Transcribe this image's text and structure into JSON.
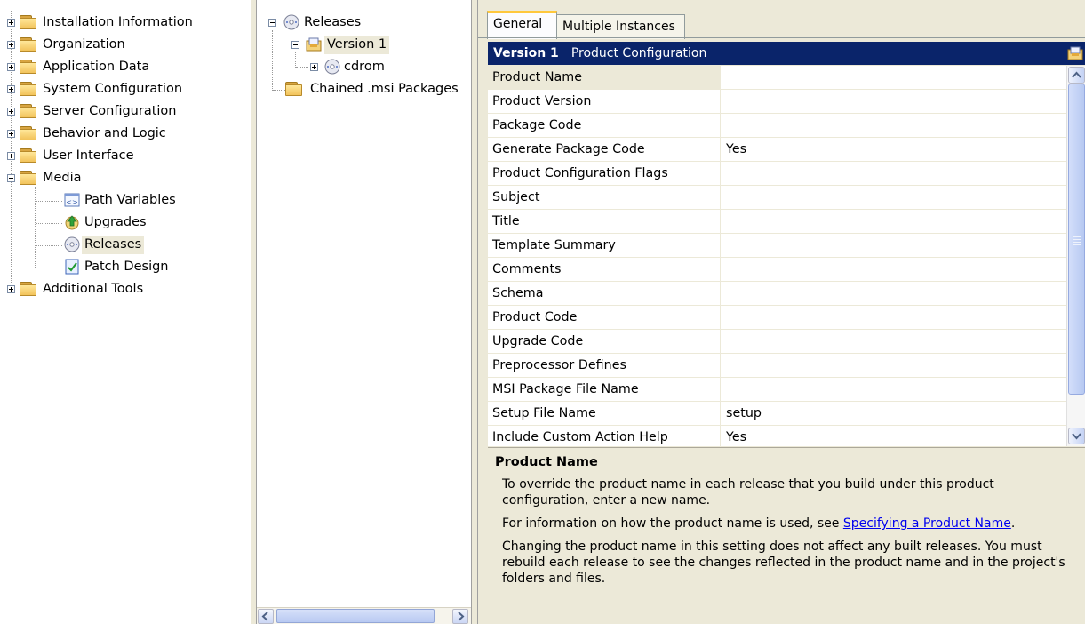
{
  "nav_tree": {
    "items": [
      {
        "label": "Installation Information",
        "expanded": false,
        "icon": "folder-icon"
      },
      {
        "label": "Organization",
        "expanded": false,
        "icon": "folder-icon"
      },
      {
        "label": "Application Data",
        "expanded": false,
        "icon": "folder-icon"
      },
      {
        "label": "System Configuration",
        "expanded": false,
        "icon": "folder-icon"
      },
      {
        "label": "Server Configuration",
        "expanded": false,
        "icon": "folder-icon"
      },
      {
        "label": "Behavior and Logic",
        "expanded": false,
        "icon": "folder-icon"
      },
      {
        "label": "User Interface",
        "expanded": false,
        "icon": "folder-icon"
      },
      {
        "label": "Media",
        "expanded": true,
        "icon": "folder-open-icon",
        "children": [
          {
            "label": "Path Variables",
            "icon": "path-variables-icon"
          },
          {
            "label": "Upgrades",
            "icon": "upgrades-icon"
          },
          {
            "label": "Releases",
            "icon": "releases-cd-icon",
            "selected": true
          },
          {
            "label": "Patch Design",
            "icon": "patch-design-icon"
          }
        ]
      },
      {
        "label": "Additional Tools",
        "expanded": false,
        "icon": "folder-icon"
      }
    ]
  },
  "release_tree": {
    "root": {
      "label": "Releases",
      "icon": "releases-cd-icon"
    },
    "version": {
      "label": "Version 1",
      "icon": "product-config-icon",
      "selected": true
    },
    "media": {
      "label": "cdrom",
      "icon": "cd-icon"
    },
    "chained": {
      "label": "Chained .msi Packages",
      "icon": "folder-icon"
    }
  },
  "tabs": [
    {
      "label": "General",
      "active": true
    },
    {
      "label": "Multiple Instances",
      "active": false
    }
  ],
  "properties": {
    "header_name": "Version 1",
    "header_type": "Product Configuration",
    "rows": [
      {
        "name": "Product Name",
        "value": ""
      },
      {
        "name": "Product Version",
        "value": ""
      },
      {
        "name": "Package Code",
        "value": ""
      },
      {
        "name": "Generate Package Code",
        "value": "Yes"
      },
      {
        "name": "Product Configuration Flags",
        "value": ""
      },
      {
        "name": "Subject",
        "value": ""
      },
      {
        "name": "Title",
        "value": ""
      },
      {
        "name": "Template Summary",
        "value": ""
      },
      {
        "name": "Comments",
        "value": ""
      },
      {
        "name": "Schema",
        "value": ""
      },
      {
        "name": "Product Code",
        "value": ""
      },
      {
        "name": "Upgrade Code",
        "value": ""
      },
      {
        "name": "Preprocessor Defines",
        "value": ""
      },
      {
        "name": "MSI Package File Name",
        "value": ""
      },
      {
        "name": "Setup File Name",
        "value": "setup"
      },
      {
        "name": "Include Custom Action Help",
        "value": "Yes"
      }
    ]
  },
  "help": {
    "title": "Product Name",
    "p1": "To override the product name in each release that you build under this product configuration, enter a new name.",
    "p2_prefix": "For information on how the product name is used, see ",
    "p2_link": "Specifying a Product Name",
    "p2_suffix": ".",
    "p3": "Changing the product name in this setting does not affect any built releases. You must rebuild each release to see the changes reflected in the product name and in the project's folders and files."
  },
  "colors": {
    "header_bg": "#0a246a",
    "selection_bg": "#ece9d8",
    "link": "#0000ee"
  }
}
